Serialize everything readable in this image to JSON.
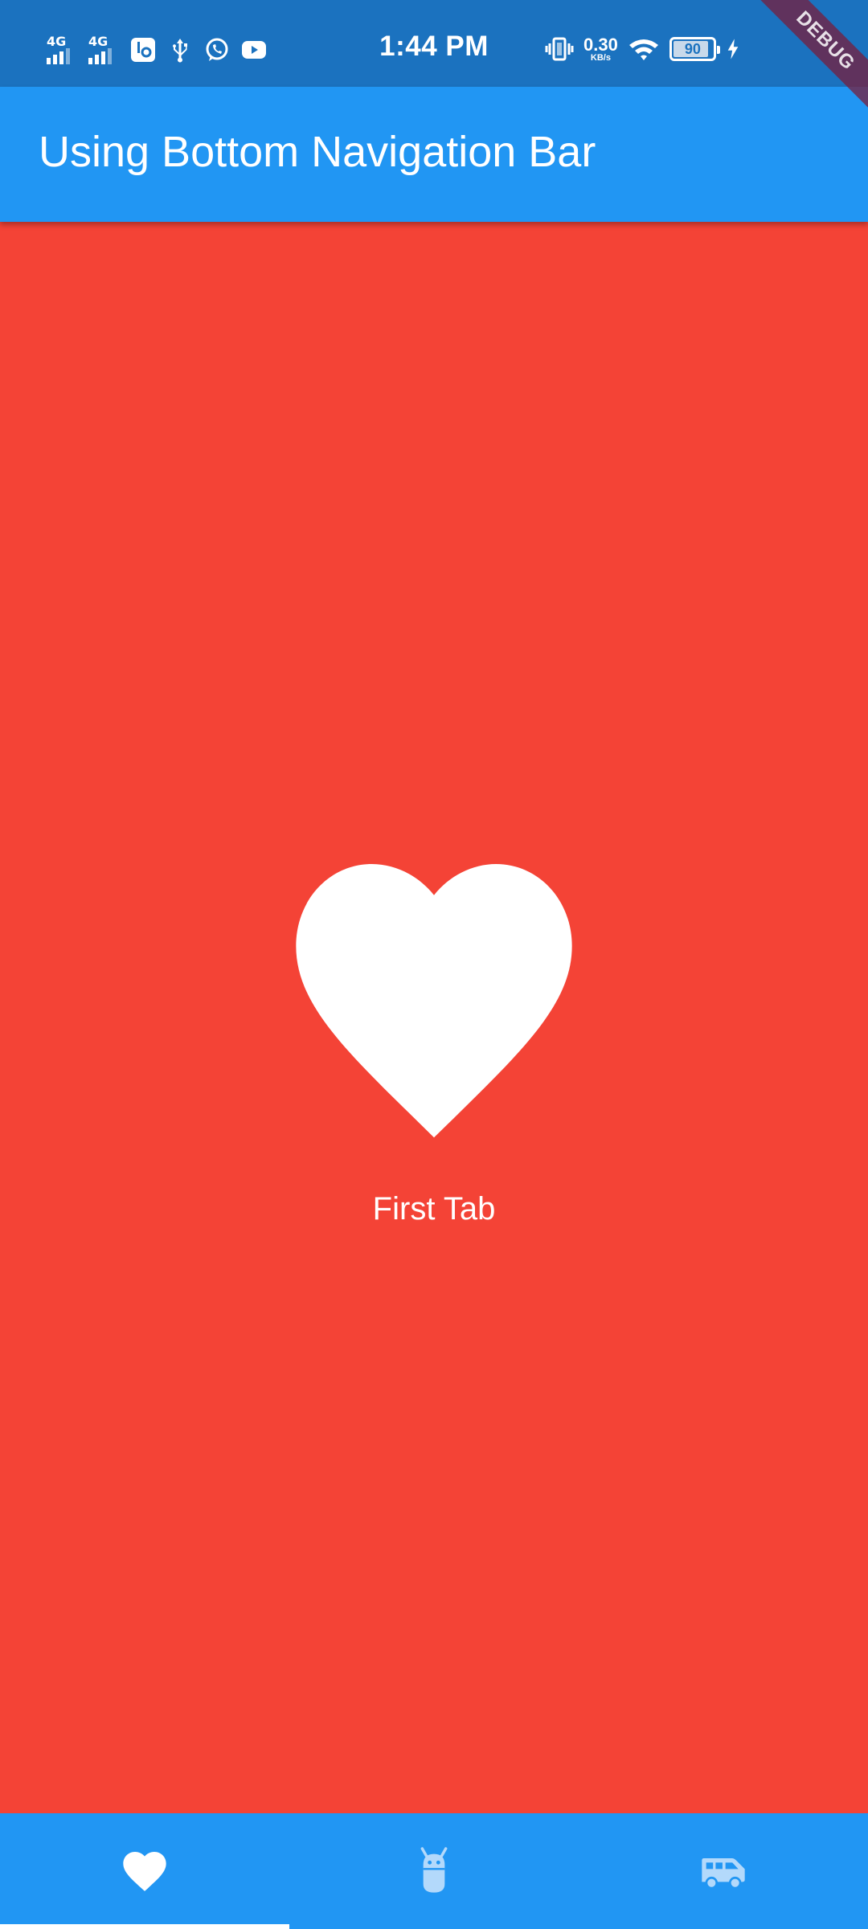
{
  "status_bar": {
    "network_1": "4G",
    "network_2": "4G",
    "time": "1:44 PM",
    "speed_value": "0.30",
    "speed_unit": "KB/s",
    "battery": "90",
    "battery_level": 0.9,
    "icons_left": [
      "signal-4g-icon",
      "signal-4g-icon",
      "settings-notification-icon",
      "usb-icon",
      "whatsapp-icon",
      "youtube-icon"
    ],
    "icons_right": [
      "vibrate-icon",
      "wifi-icon",
      "battery-icon",
      "charging-icon"
    ]
  },
  "debug_banner": "DEBUG",
  "app_bar": {
    "title": "Using Bottom Navigation Bar"
  },
  "content": {
    "icon": "favorite-icon",
    "label": "First Tab"
  },
  "bottom_nav": {
    "items": [
      {
        "icon": "favorite-icon",
        "selected": true
      },
      {
        "icon": "android-icon",
        "selected": false
      },
      {
        "icon": "van-icon",
        "selected": false
      }
    ]
  },
  "colors": {
    "status_bar": "#1b72bf",
    "app_bar": "#2196f3",
    "content_background": "#f44336",
    "selected_icon": "#ffffff",
    "unselected_icon": "#b3d9fb"
  }
}
